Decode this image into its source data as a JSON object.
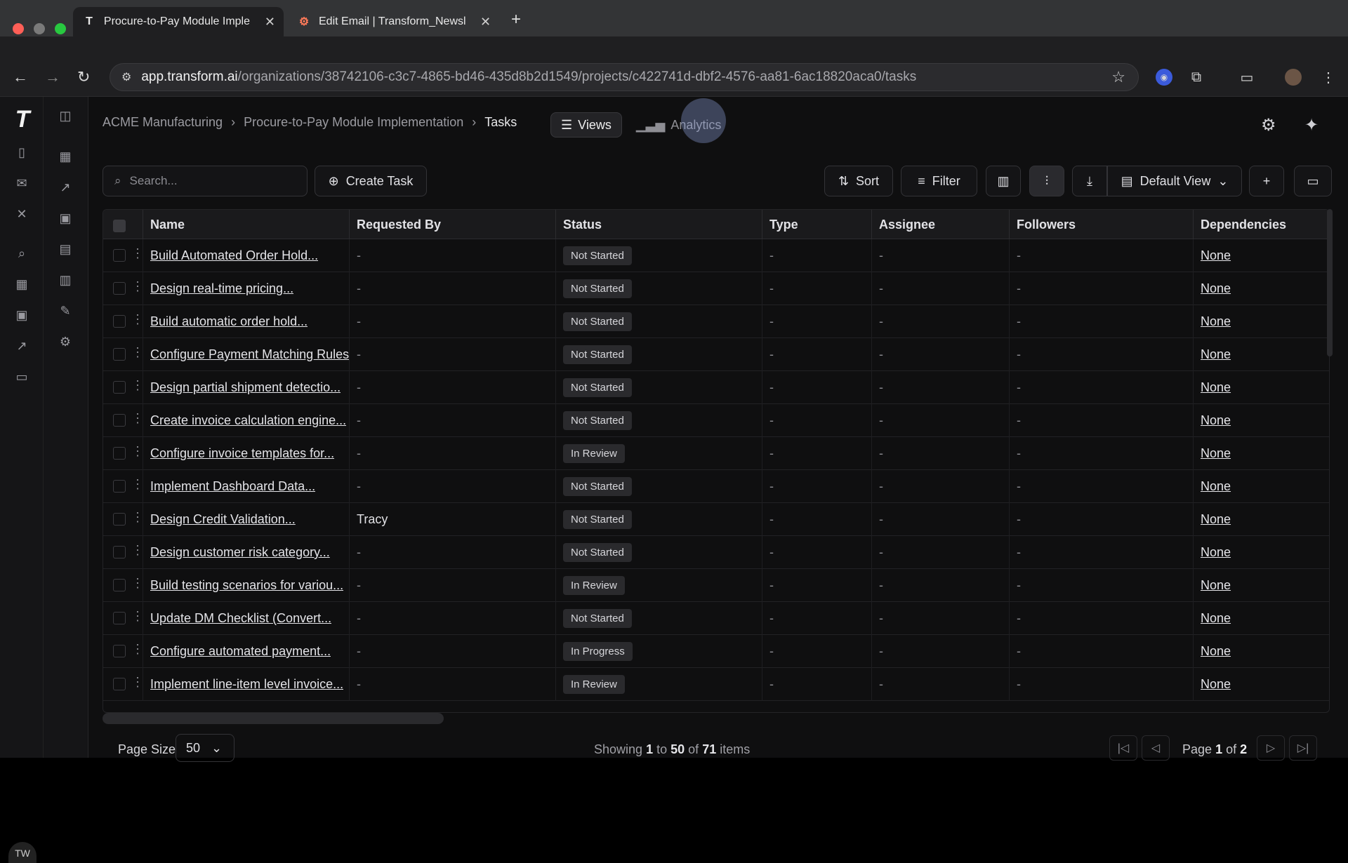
{
  "browser": {
    "tabs": [
      {
        "title": "Procure-to-Pay Module Imple",
        "favicon": "T"
      },
      {
        "title": "Edit Email | Transform_Newsl",
        "favicon": "hubspot-icon"
      }
    ],
    "url_host": "app.transform.ai",
    "url_path": "/organizations/38742106-c3c7-4865-bd46-435d8b2d1549/projects/c422741d-dbf2-4576-aa81-6ac18820aca0/tasks"
  },
  "breadcrumb": {
    "org": "ACME Manufacturing",
    "project": "Procure-to-Pay Module Implementation",
    "page": "Tasks"
  },
  "view_tabs": {
    "views": "Views",
    "analytics": "Analytics"
  },
  "toolbar": {
    "search_placeholder": "Search...",
    "create_task": "Create Task",
    "sort": "Sort",
    "filter": "Filter",
    "default_view": "Default View"
  },
  "columns": [
    "Name",
    "Requested By",
    "Status",
    "Type",
    "Assignee",
    "Followers",
    "Dependencies"
  ],
  "rows": [
    {
      "name": "Build Automated Order Hold...",
      "requested_by": "-",
      "status": "Not Started",
      "type": "-",
      "assignee": "-",
      "followers": "-",
      "dependencies": "None"
    },
    {
      "name": "Design real-time pricing...",
      "requested_by": "-",
      "status": "Not Started",
      "type": "-",
      "assignee": "-",
      "followers": "-",
      "dependencies": "None"
    },
    {
      "name": "Build automatic order hold...",
      "requested_by": "-",
      "status": "Not Started",
      "type": "-",
      "assignee": "-",
      "followers": "-",
      "dependencies": "None"
    },
    {
      "name": "Configure Payment Matching Rules",
      "requested_by": "-",
      "status": "Not Started",
      "type": "-",
      "assignee": "-",
      "followers": "-",
      "dependencies": "None"
    },
    {
      "name": "Design partial shipment detectio...",
      "requested_by": "-",
      "status": "Not Started",
      "type": "-",
      "assignee": "-",
      "followers": "-",
      "dependencies": "None"
    },
    {
      "name": "Create invoice calculation engine...",
      "requested_by": "-",
      "status": "Not Started",
      "type": "-",
      "assignee": "-",
      "followers": "-",
      "dependencies": "None"
    },
    {
      "name": "Configure invoice templates for...",
      "requested_by": "-",
      "status": "In Review",
      "type": "-",
      "assignee": "-",
      "followers": "-",
      "dependencies": "None"
    },
    {
      "name": "Implement Dashboard Data...",
      "requested_by": "-",
      "status": "Not Started",
      "type": "-",
      "assignee": "-",
      "followers": "-",
      "dependencies": "None"
    },
    {
      "name": "Design Credit Validation...",
      "requested_by": "Tracy",
      "status": "Not Started",
      "type": "-",
      "assignee": "-",
      "followers": "-",
      "dependencies": "None"
    },
    {
      "name": "Design customer risk category...",
      "requested_by": "-",
      "status": "Not Started",
      "type": "-",
      "assignee": "-",
      "followers": "-",
      "dependencies": "None"
    },
    {
      "name": "Build testing scenarios for variou...",
      "requested_by": "-",
      "status": "In Review",
      "type": "-",
      "assignee": "-",
      "followers": "-",
      "dependencies": "None"
    },
    {
      "name": "Update DM Checklist (Convert...",
      "requested_by": "-",
      "status": "Not Started",
      "type": "-",
      "assignee": "-",
      "followers": "-",
      "dependencies": "None"
    },
    {
      "name": "Configure automated payment...",
      "requested_by": "-",
      "status": "In Progress",
      "type": "-",
      "assignee": "-",
      "followers": "-",
      "dependencies": "None"
    },
    {
      "name": "Implement line-item level invoice...",
      "requested_by": "-",
      "status": "In Review",
      "type": "-",
      "assignee": "-",
      "followers": "-",
      "dependencies": "None"
    }
  ],
  "pagination": {
    "page_size_label": "Page Size",
    "page_size": "50",
    "showing_prefix": "Showing",
    "from": "1",
    "to_word": "to",
    "to": "50",
    "of_word": "of",
    "total": "71",
    "items_word": "items",
    "page_word": "Page",
    "page": "1",
    "of_pages_word": "of",
    "pages": "2"
  },
  "user_initials": "TW"
}
